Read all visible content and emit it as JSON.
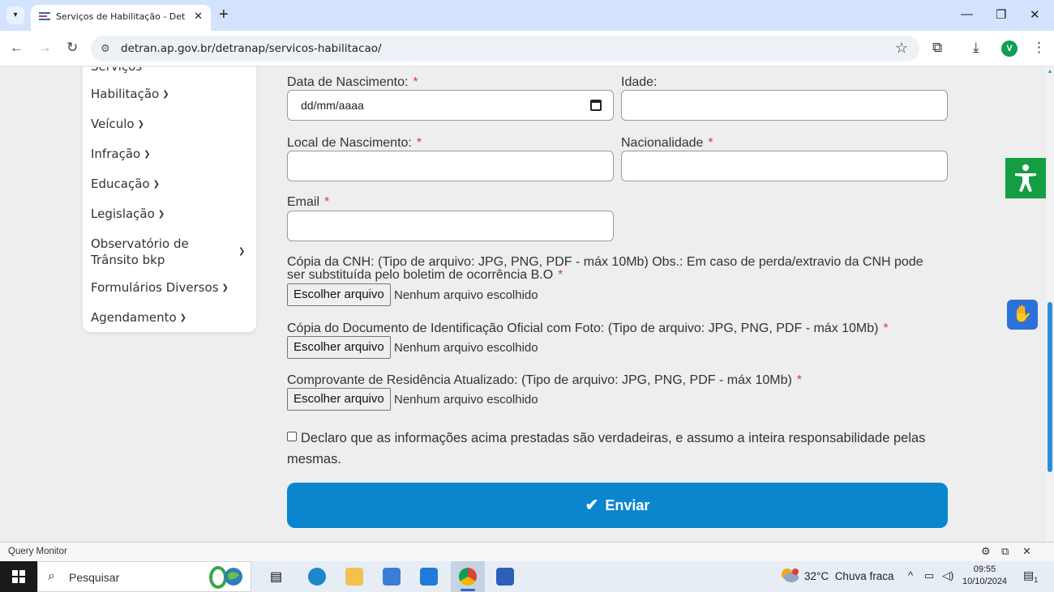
{
  "browser": {
    "tab_title": "Serviços de Habilitação - Detran",
    "url": "detran.ap.gov.br/detranap/servicos-habilitacao/",
    "avatar_letter": "V"
  },
  "sidebar": {
    "cut_item": "Serviços",
    "items": [
      {
        "label": "Habilitação"
      },
      {
        "label": "Veículo"
      },
      {
        "label": "Infração"
      },
      {
        "label": "Educação"
      },
      {
        "label": "Legislação"
      },
      {
        "label": "Observatório de Trânsito bkp"
      },
      {
        "label": "Formulários Diversos"
      },
      {
        "label": "Agendamento"
      }
    ]
  },
  "form": {
    "birth_date_label": "Data de Nascimento:",
    "birth_date_placeholder": "dd/mm/aaaa",
    "age_label": "Idade:",
    "birth_place_label": "Local de Nascimento:",
    "nationality_label": "Nacionalidade",
    "email_label": "Email",
    "required_mark": "*",
    "cnh_label": "Cópia da CNH: (Tipo de arquivo: JPG, PNG, PDF - máx 10Mb) Obs.: Em caso de perda/extravio da CNH pode ser substituída pelo boletim de ocorrência B.O",
    "id_doc_label": "Cópia do Documento de Identificação Oficial com Foto: (Tipo de arquivo: JPG, PNG, PDF - máx 10Mb)",
    "residence_label": "Comprovante de Residência Atualizado: (Tipo de arquivo: JPG, PNG, PDF - máx 10Mb)",
    "file_button_label": "Escolher arquivo",
    "file_status": "Nenhum arquivo escolhido",
    "declaration": "Declaro que as informações acima prestadas são verdadeiras, e assumo a inteira responsabilidade pelas mesmas.",
    "submit_label": "Enviar"
  },
  "query_monitor": {
    "title": "Query Monitor"
  },
  "taskbar": {
    "search_placeholder": "Pesquisar",
    "weather_temp": "32°C",
    "weather_desc": "Chuva fraca",
    "time": "09:55",
    "date": "10/10/2024",
    "notification_count": "1"
  },
  "colors": {
    "accent": "#0a86cf",
    "required": "#e53935",
    "accessibility": "#149e43",
    "libras": "#2b71d9"
  }
}
